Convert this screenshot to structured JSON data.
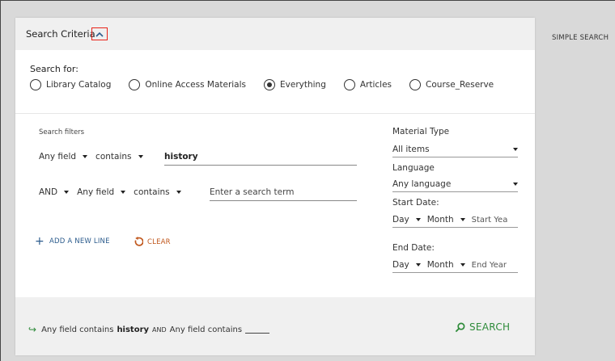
{
  "panel": {
    "title": "Search Criteria"
  },
  "search_for": {
    "label": "Search for:",
    "options": [
      {
        "label": "Library Catalog",
        "checked": false
      },
      {
        "label": "Online Access Materials",
        "checked": false
      },
      {
        "label": "Everything",
        "checked": true
      },
      {
        "label": "Articles",
        "checked": false
      },
      {
        "label": "Course_Reserve",
        "checked": false
      }
    ]
  },
  "filters": {
    "label": "Search filters",
    "row1": {
      "field": "Any field",
      "operator": "contains",
      "term": "history"
    },
    "row2": {
      "boolean": "AND",
      "field": "Any field",
      "operator": "contains",
      "placeholder": "Enter a search term"
    },
    "add_line": "ADD A NEW LINE",
    "clear": "CLEAR"
  },
  "side": {
    "material_type_label": "Material Type",
    "material_type_value": "All items",
    "language_label": "Language",
    "language_value": "Any language",
    "start_date_label": "Start Date:",
    "start_day": "Day",
    "start_month": "Month",
    "start_year_placeholder": "Start Yea",
    "end_date_label": "End Date:",
    "end_day": "Day",
    "end_month": "Month",
    "end_year_placeholder": "End Year"
  },
  "summary": {
    "part1": "Any field contains",
    "term": "history",
    "boolean": "AND",
    "part2": "Any field contains"
  },
  "search_button": "SEARCH",
  "simple_search": "SIMPLE SEARCH",
  "colors": {
    "accent_green": "#2e8b3a",
    "link_blue": "#2b5b8c",
    "clear_orange": "#c0571c",
    "highlight_red": "#e8241a"
  }
}
